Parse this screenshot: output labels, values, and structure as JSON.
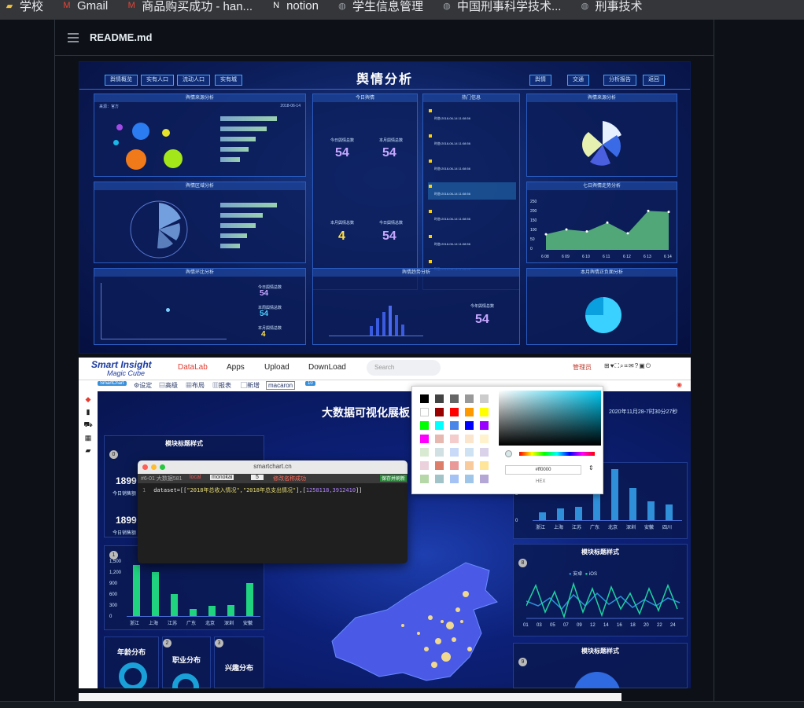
{
  "bookmarks": [
    {
      "label": "学校",
      "icon": "folder-icon"
    },
    {
      "label": "Gmail",
      "icon": "gmail-icon"
    },
    {
      "label": "商品购买成功 - han...",
      "icon": "gmail-icon"
    },
    {
      "label": "notion",
      "icon": "notion-icon"
    },
    {
      "label": "学生信息管理",
      "icon": "globe-icon"
    },
    {
      "label": "中国刑事科学技术...",
      "icon": "globe-icon"
    },
    {
      "label": "刑事技术",
      "icon": "globe-icon"
    }
  ],
  "readme": {
    "title": "README.md"
  },
  "shot1": {
    "title": "舆情分析",
    "nav_left": [
      "舆情概览",
      "实有人口",
      "流动人口",
      "实有城"
    ],
    "nav_right": [
      "舆情",
      "交通",
      "分析报告",
      "返回"
    ],
    "panels": {
      "p1": "舆情来源分析",
      "p2": "今日舆情",
      "p3": "热门信息",
      "p4": "舆情来源分析",
      "p5": "舆情区域分析",
      "p6": "七日舆情走势分析",
      "p7": "舆情环比分析",
      "p8": "舆情趋势分析",
      "p9": "本月舆情正负面分析"
    },
    "p1_meta": {
      "left": "来源：官方",
      "right": "2018-06-14"
    },
    "p2_cells": [
      {
        "label": "今日舆情总数",
        "value": "54"
      },
      {
        "label": "本月舆情总数",
        "value": "54"
      },
      {
        "label": "本月舆情总数",
        "value": "4"
      },
      {
        "label": "今日舆情总数",
        "value": "54"
      }
    ],
    "p7_cells": [
      {
        "label": "今日舆情总数",
        "value": "54"
      },
      {
        "label": "本周舆情总数",
        "value": "54"
      },
      {
        "label": "本月舆情总数",
        "value": "4"
      }
    ],
    "p8_number": {
      "label": "今年舆情总数",
      "value": "54"
    },
    "news": [
      "时态:2018-06-14 11:08:56",
      "时态:2018-06-14 11:08:56",
      "时态:2018-06-14 11:08:56",
      "时态:2018-06-14 11:08:56",
      "时态:2018-06-14 11:08:56",
      "时态:2018-06-14 11:08:56",
      "时态:2018-06-14 11:08:56"
    ],
    "bars_top": [
      0.8,
      0.65,
      0.5,
      0.4,
      0.28
    ],
    "bars_mid": [
      0.8,
      0.6,
      0.5,
      0.38,
      0.28
    ],
    "trend_x": [
      "6 08",
      "6 09",
      "6 10",
      "6 11",
      "6 12",
      "6 13",
      "6 14"
    ],
    "trend_y": [
      80,
      105,
      95,
      140,
      85,
      200,
      195
    ],
    "trend_yticks": [
      "250",
      "200",
      "150",
      "100",
      "50",
      "0"
    ]
  },
  "shot2": {
    "logo": "Smart Insight",
    "logo_sub": "Magic Cube",
    "nav": [
      "DataLab",
      "Apps",
      "Upload",
      "DownLoad"
    ],
    "search_placeholder": "Search",
    "admin": "管理员",
    "toolbar": [
      "SmartChart",
      "设定",
      "高级",
      "布局",
      "报表",
      "新增"
    ],
    "theme_select": "macaron",
    "count_badge": "10",
    "dash_title": "大数据可视化展板",
    "dash_date": "2020年11月28-7时30分27秒",
    "module_title": "模块标题样式",
    "stat_values": [
      {
        "value": "1899",
        "label": "今日销售额"
      },
      {
        "value": "1899",
        "label": "今日销售额"
      }
    ],
    "green_bars": {
      "categories": [
        "浙江",
        "上海",
        "江苏",
        "广东",
        "北京",
        "深圳",
        "安徽"
      ],
      "values": [
        1400,
        1200,
        600,
        200,
        280,
        300,
        900
      ],
      "yticks": [
        "1,500",
        "1,200",
        "900",
        "600",
        "300",
        "0"
      ]
    },
    "blue_bars": {
      "categories": [
        "浙江",
        "上海",
        "江苏",
        "广东",
        "北京",
        "深圳",
        "安徽",
        "四川"
      ],
      "values": [
        1.5,
        2.2,
        2.5,
        5.5,
        9.5,
        6,
        3.5,
        3
      ],
      "yticks": [
        "6",
        "3",
        "0"
      ]
    },
    "line_chart": {
      "legend": [
        "安卓",
        "iOS"
      ],
      "x": [
        "01",
        "03",
        "05",
        "07",
        "09",
        "12",
        "14",
        "16",
        "18",
        "20",
        "22",
        "24"
      ],
      "yticks": [
        "8",
        "6",
        "4",
        "2",
        "0"
      ]
    },
    "section_labels": [
      "年龄分布",
      "职业分布",
      "兴趣分布"
    ],
    "badges": [
      "0",
      "5",
      "1",
      "8",
      "2",
      "3",
      "4",
      "9"
    ],
    "editor": {
      "url": "smartchart.cn",
      "tab": "#6-01 大数据581",
      "local": "local",
      "theme": "monokai",
      "size": "5",
      "status": "修改名称成功",
      "save": "保存并刷新",
      "line_no": "1",
      "code_prefix": "dataset=[[",
      "code_strs": "\"2018年总收入情况\",\"2018年总支出情况\"",
      "code_mid": "],[",
      "code_nums": "1258118,3912410",
      "code_suffix": "]]"
    },
    "picker": {
      "hex": "#ff0000",
      "hex_label": "HEX"
    },
    "picker_swatches": [
      "#000000",
      "#434343",
      "#666666",
      "#999999",
      "#cccccc",
      "#ffffff",
      "#990000",
      "#ff0000",
      "#ff9900",
      "#ffff00",
      "#00ff00",
      "#00ffff",
      "#4a86e8",
      "#0000ff",
      "#9900ff",
      "#ff00ff",
      "#e6b8af",
      "#f4cccc",
      "#fce5cd",
      "#fff2cc",
      "#d9ead3",
      "#d0e0e3",
      "#c9daf8",
      "#cfe2f3",
      "#d9d2e9",
      "#ead1dc",
      "#dd7e6b",
      "#ea9999",
      "#f9cb9c",
      "#ffe599",
      "#b6d7a8",
      "#a2c4c9",
      "#a4c2f4",
      "#9fc5e8",
      "#b4a7d6"
    ]
  }
}
